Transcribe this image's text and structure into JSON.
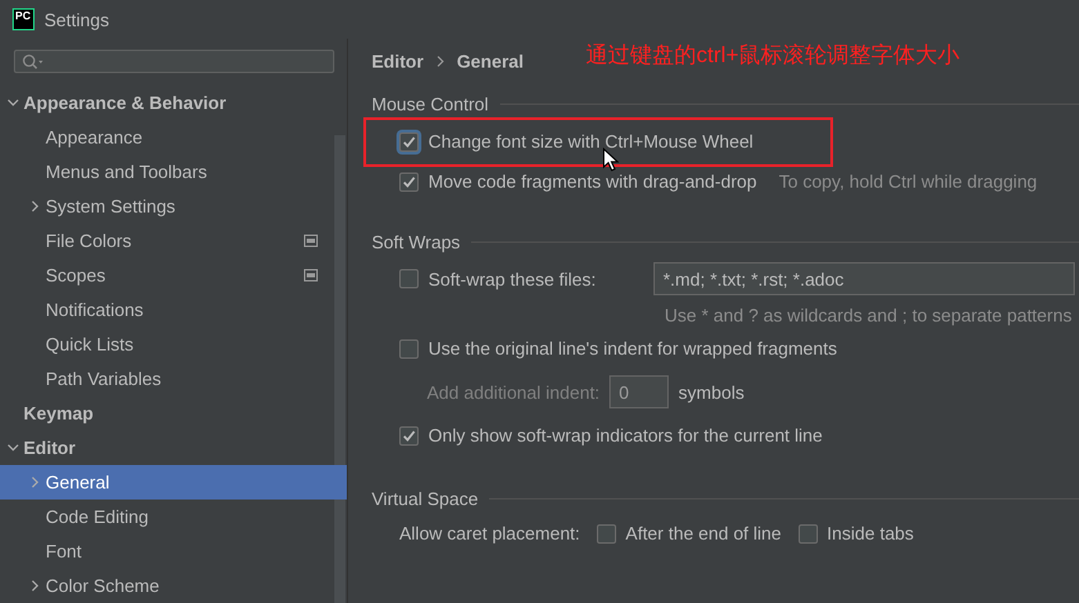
{
  "window": {
    "logo": "PC",
    "title": "Settings"
  },
  "sidebar": {
    "tree": [
      {
        "label": "Appearance & Behavior",
        "expanded": true,
        "selected": false,
        "children": [
          {
            "label": "Appearance",
            "selected": false
          },
          {
            "label": "Menus and Toolbars",
            "selected": false
          },
          {
            "label": "System Settings",
            "expanded": false,
            "selected": false
          },
          {
            "label": "File Colors",
            "selected": false,
            "scope_icon": true
          },
          {
            "label": "Scopes",
            "selected": false,
            "scope_icon": true
          },
          {
            "label": "Notifications",
            "selected": false
          },
          {
            "label": "Quick Lists",
            "selected": false
          },
          {
            "label": "Path Variables",
            "selected": false
          }
        ]
      },
      {
        "label": "Keymap",
        "selected": false
      },
      {
        "label": "Editor",
        "expanded": true,
        "selected": false,
        "children": [
          {
            "label": "General",
            "expanded": false,
            "selected": true
          },
          {
            "label": "Code Editing",
            "selected": false
          },
          {
            "label": "Font",
            "selected": false
          },
          {
            "label": "Color Scheme",
            "expanded": false,
            "selected": false
          }
        ]
      }
    ]
  },
  "breadcrumb": [
    "Editor",
    "General"
  ],
  "annotation": {
    "text": "通过键盘的ctrl+鼠标滚轮调整字体大小"
  },
  "sections": [
    {
      "title": "Mouse Control",
      "rows": [
        {
          "kind": "checkbox",
          "label": "Change font size with Ctrl+Mouse Wheel",
          "checked": true,
          "focused": true,
          "highlighted": true,
          "pointer": true
        },
        {
          "kind": "checkbox",
          "label": "Move code fragments with drag-and-drop",
          "checked": true,
          "hint": "To copy, hold Ctrl while dragging"
        }
      ]
    },
    {
      "title": "Soft Wraps",
      "rows": [
        {
          "kind": "checkbox_field",
          "label": "Soft-wrap these files:",
          "checked": false,
          "value": "*.md; *.txt; *.rst; *.adoc",
          "note": "Use * and ? as wildcards and ; to separate patterns"
        },
        {
          "kind": "checkbox",
          "label": "Use the original line's indent for wrapped fragments",
          "checked": false
        },
        {
          "kind": "number_field",
          "label": "Add additional indent:",
          "value": "0",
          "unit": "symbols",
          "disabled": true
        },
        {
          "kind": "checkbox",
          "label": "Only show soft-wrap indicators for the current line",
          "checked": true
        }
      ]
    },
    {
      "title": "Virtual Space",
      "rows": [
        {
          "kind": "options",
          "label": "Allow caret placement:",
          "options": [
            {
              "label": "After the end of line",
              "checked": false
            },
            {
              "label": "Inside tabs",
              "checked": false
            }
          ]
        }
      ]
    }
  ]
}
